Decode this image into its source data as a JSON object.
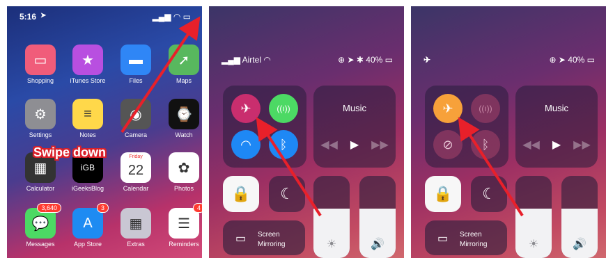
{
  "home": {
    "time": "5:16",
    "apps": [
      {
        "name": "shopping",
        "label": "Shopping",
        "color": "#f05c7a",
        "glyph": "▭"
      },
      {
        "name": "itunes-store",
        "label": "iTunes Store",
        "color": "#b84fe0",
        "glyph": "★"
      },
      {
        "name": "files",
        "label": "Files",
        "color": "#2f86f6",
        "glyph": "▬"
      },
      {
        "name": "maps",
        "label": "Maps",
        "color": "#58b85e",
        "glyph": "➚"
      },
      {
        "name": "settings",
        "label": "Settings",
        "color": "#8e8e93",
        "glyph": "⚙"
      },
      {
        "name": "notes",
        "label": "Notes",
        "color": "#ffd84a",
        "glyph": "≡"
      },
      {
        "name": "camera",
        "label": "Camera",
        "color": "#555",
        "glyph": "◉"
      },
      {
        "name": "watch",
        "label": "Watch",
        "color": "#111",
        "glyph": "⌚"
      },
      {
        "name": "calculator",
        "label": "Calculator",
        "color": "#333",
        "glyph": "▦"
      },
      {
        "name": "igeeksblog",
        "label": "iGeeksBlog",
        "color": "#000",
        "glyph": "iGB"
      },
      {
        "name": "calendar",
        "label": "Calendar",
        "color": "#fff",
        "glyph": "22",
        "sub": "Friday"
      },
      {
        "name": "photos",
        "label": "Photos",
        "color": "#fff",
        "glyph": "✿"
      },
      {
        "name": "messages",
        "label": "Messages",
        "color": "#4cd964",
        "glyph": "💬",
        "badge": "3,640"
      },
      {
        "name": "app-store",
        "label": "App Store",
        "color": "#1e8bf2",
        "glyph": "A",
        "badge": "3"
      },
      {
        "name": "extras",
        "label": "Extras",
        "color": "#c9c7d3",
        "glyph": "▦"
      },
      {
        "name": "reminders",
        "label": "Reminders",
        "color": "#fff",
        "glyph": "☰",
        "badge": "4"
      }
    ],
    "annotation": "Swipe down"
  },
  "cc_before": {
    "carrier": "Airtel",
    "battery": "40%",
    "music_label": "Music",
    "mirroring_line1": "Screen",
    "mirroring_line2": "Mirroring",
    "airplane_color": "#c92e6e",
    "cellular_color": "#4cd964",
    "wifi_color": "#1e88f5",
    "bluetooth_color": "#1e88f5"
  },
  "cc_after": {
    "battery": "40%",
    "music_label": "Music",
    "mirroring_line1": "Screen",
    "mirroring_line2": "Mirroring",
    "airplane_color": "#f7a13a"
  }
}
